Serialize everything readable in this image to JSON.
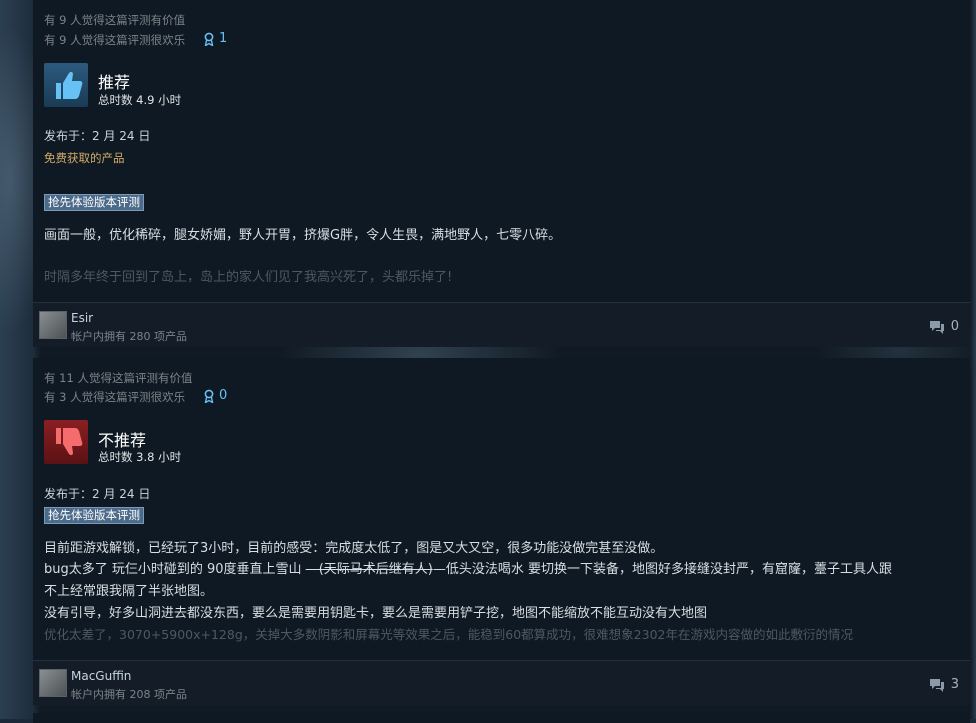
{
  "reviews": [
    {
      "helpful": "有 9 人觉得这篇评测有价值",
      "funny": "有 9 人觉得这篇评测很欢乐",
      "award_count": "1",
      "verdict": "推荐",
      "hours": "总时数 4.9 小时",
      "posted": "发布于：2 月 24 日",
      "free_product": "免费获取的产品",
      "early_access": "抢先体验版本评测",
      "body_lines": [
        "画面一般，优化稀碎，腿女娇媚，野人开胃，挤爆G胖，令人生畏，满地野人，七零八碎。",
        "时隔多年终于回到了岛上，岛上的家人们见了我高兴死了，头都乐掉了!"
      ],
      "author": "Esir",
      "owns": "帐户内拥有 280 项产品",
      "comments": "0"
    },
    {
      "helpful": "有 11 人觉得这篇评测有价值",
      "funny": "有 3 人觉得这篇评测很欢乐",
      "award_count": "0",
      "verdict": "不推荐",
      "hours": "总时数 3.8 小时",
      "posted": "发布于：2 月 24 日",
      "early_access": "抢先体验版本评测",
      "body_lines": [
        "目前距游戏解锁，已经玩了3小时，目前的感受：完成度太低了，图是又大又空，很多功能没做完甚至没做。",
        "bug太多了 玩仨小时碰到的 90度垂直上雪山 ",
        "—(天际马术后继有人)",
        "—低头没法喝水 要切换一下装备，地图好多接缝没封严，有窟窿，薹子工具人跟",
        "不上经常跟我隔了半张地图。",
        "没有引导，好多山洞进去都没东西，要么是需要用钥匙卡，要么是需要用铲子挖，地图不能缩放不能互动没有大地图",
        "优化太差了，3070+5900x+128g，关掉大多数阴影和屏幕光等效果之后，能稳到60都算成功，很难想象2302年在游戏内容做的如此敷衍的情况"
      ],
      "author": "MacGuffin",
      "owns": "帐户内拥有 208 项产品",
      "comments": "3"
    }
  ],
  "colors": {
    "recommend": "#2c5a7e",
    "not_recommend": "#8a1f22",
    "accent": "#66c0f4",
    "free_product": "#d2aa69"
  },
  "icons": [
    "award-icon",
    "thumbs-up-icon",
    "thumbs-down-icon",
    "comment-icon",
    "avatar"
  ]
}
